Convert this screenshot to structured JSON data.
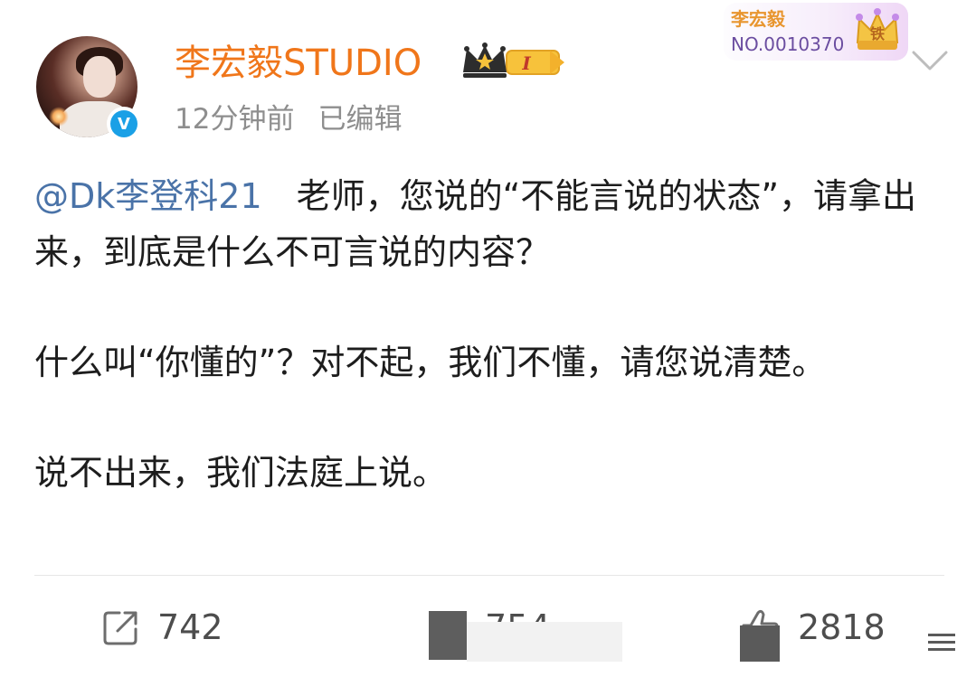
{
  "post": {
    "author_name": "李宏毅STUDIO",
    "time": "12分钟前",
    "edited": "已编辑",
    "mention": "@Dk李登科21",
    "line1": "老师，您说的“不能言说的状态”，请拿出来，到底是什么不可言说的内容？",
    "line2": "什么叫“你懂的”？对不起，我们不懂，请您说清楚。",
    "line3": "说不出来，我们法庭上说。"
  },
  "fan_card": {
    "name": "李宏毅",
    "number": "NO.0010370",
    "badge_text": "铁"
  },
  "vip": {
    "level": "I"
  },
  "verified_mark": "V",
  "actions": {
    "repost_count": "742",
    "comment_count": "754",
    "like_count": "2818"
  },
  "colors": {
    "author": "#f0761a",
    "mention": "#4a73a8",
    "meta": "#8e8e8e",
    "verified": "#1aa0e6"
  },
  "icons": {
    "repost": "share-square-icon",
    "comment": "comment-icon",
    "like": "thumbs-up-icon",
    "more": "chevron-down-icon",
    "menu": "menu-lines-icon"
  }
}
